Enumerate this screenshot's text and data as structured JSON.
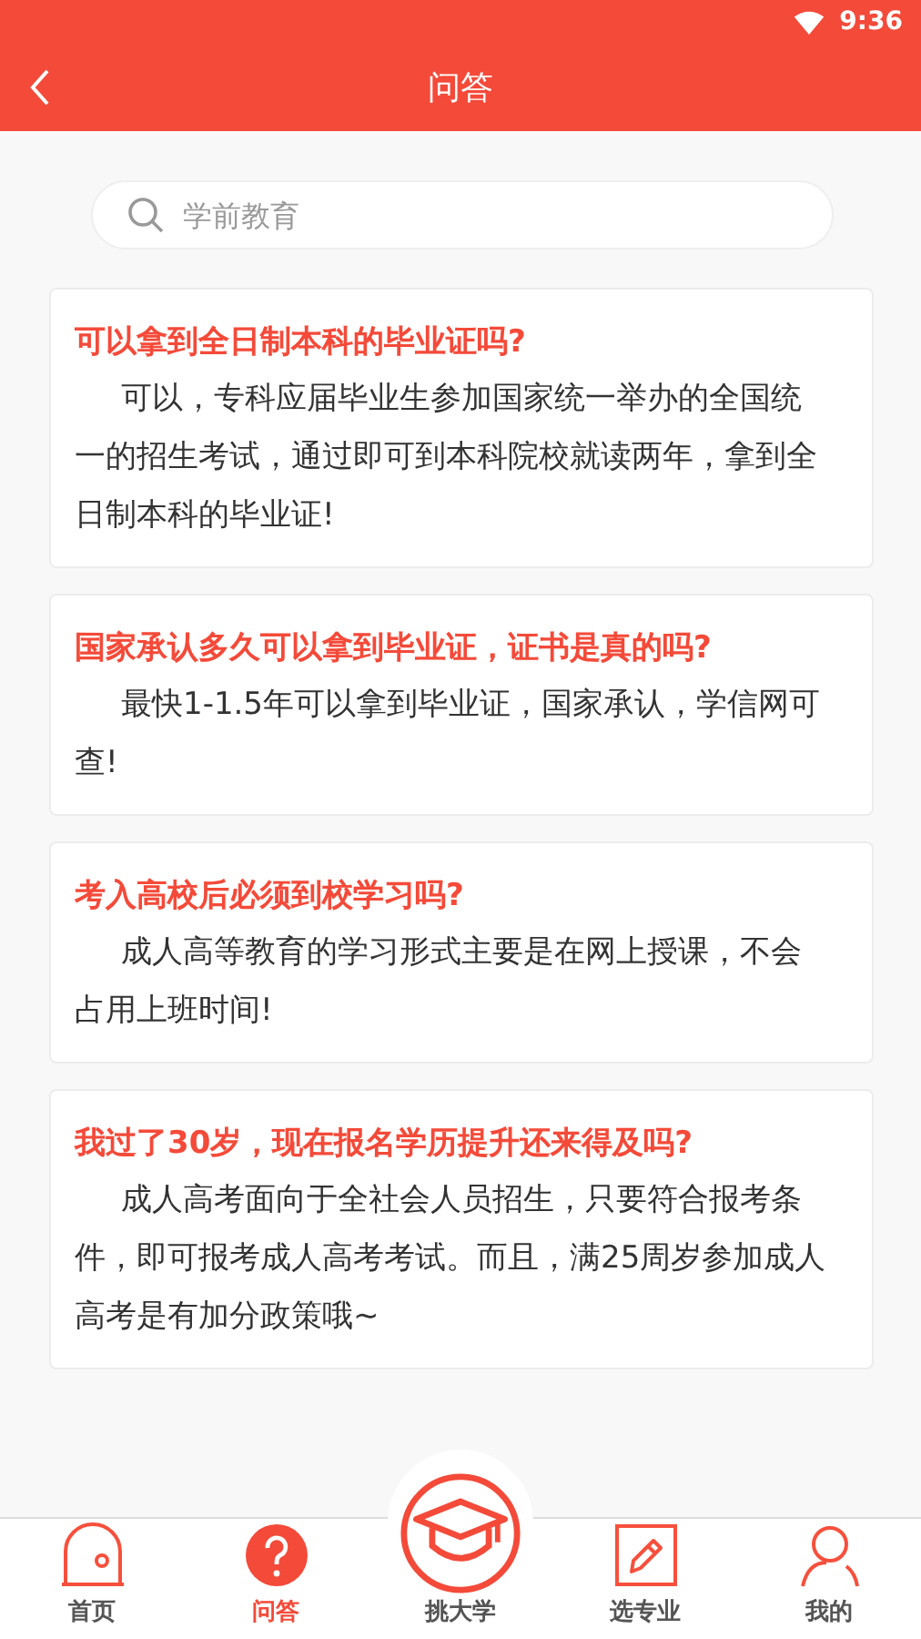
{
  "status_bar": {
    "time": "9:36"
  },
  "header": {
    "title": "问答"
  },
  "search": {
    "placeholder": "学前教育"
  },
  "questions": [
    {
      "title": "可以拿到全日制本科的毕业证吗?",
      "answer": "可以，专科应届毕业生参加国家统一举办的全国统一的招生考试，通过即可到本科院校就读两年，拿到全日制本科的毕业证!"
    },
    {
      "title": "国家承认多久可以拿到毕业证，证书是真的吗?",
      "answer": "最快1-1.5年可以拿到毕业证，国家承认，学信网可查!"
    },
    {
      "title": "考入高校后必须到校学习吗?",
      "answer": "成人高等教育的学习形式主要是在网上授课，不会占用上班时间!"
    },
    {
      "title": "我过了30岁，现在报名学历提升还来得及吗?",
      "answer": "成人高考面向于全社会人员招生，只要符合报考条件，即可报考成人高考考试。而且，满25周岁参加成人高考是有加分政策哦~"
    }
  ],
  "tabs": [
    {
      "kind": "home",
      "label": "首页",
      "selected": false
    },
    {
      "kind": "question",
      "label": "问答",
      "selected": true
    },
    {
      "kind": "school",
      "label": "挑大学",
      "selected": false
    },
    {
      "kind": "edit",
      "label": "选专业",
      "selected": false
    },
    {
      "kind": "user",
      "label": "我的",
      "selected": false
    }
  ]
}
